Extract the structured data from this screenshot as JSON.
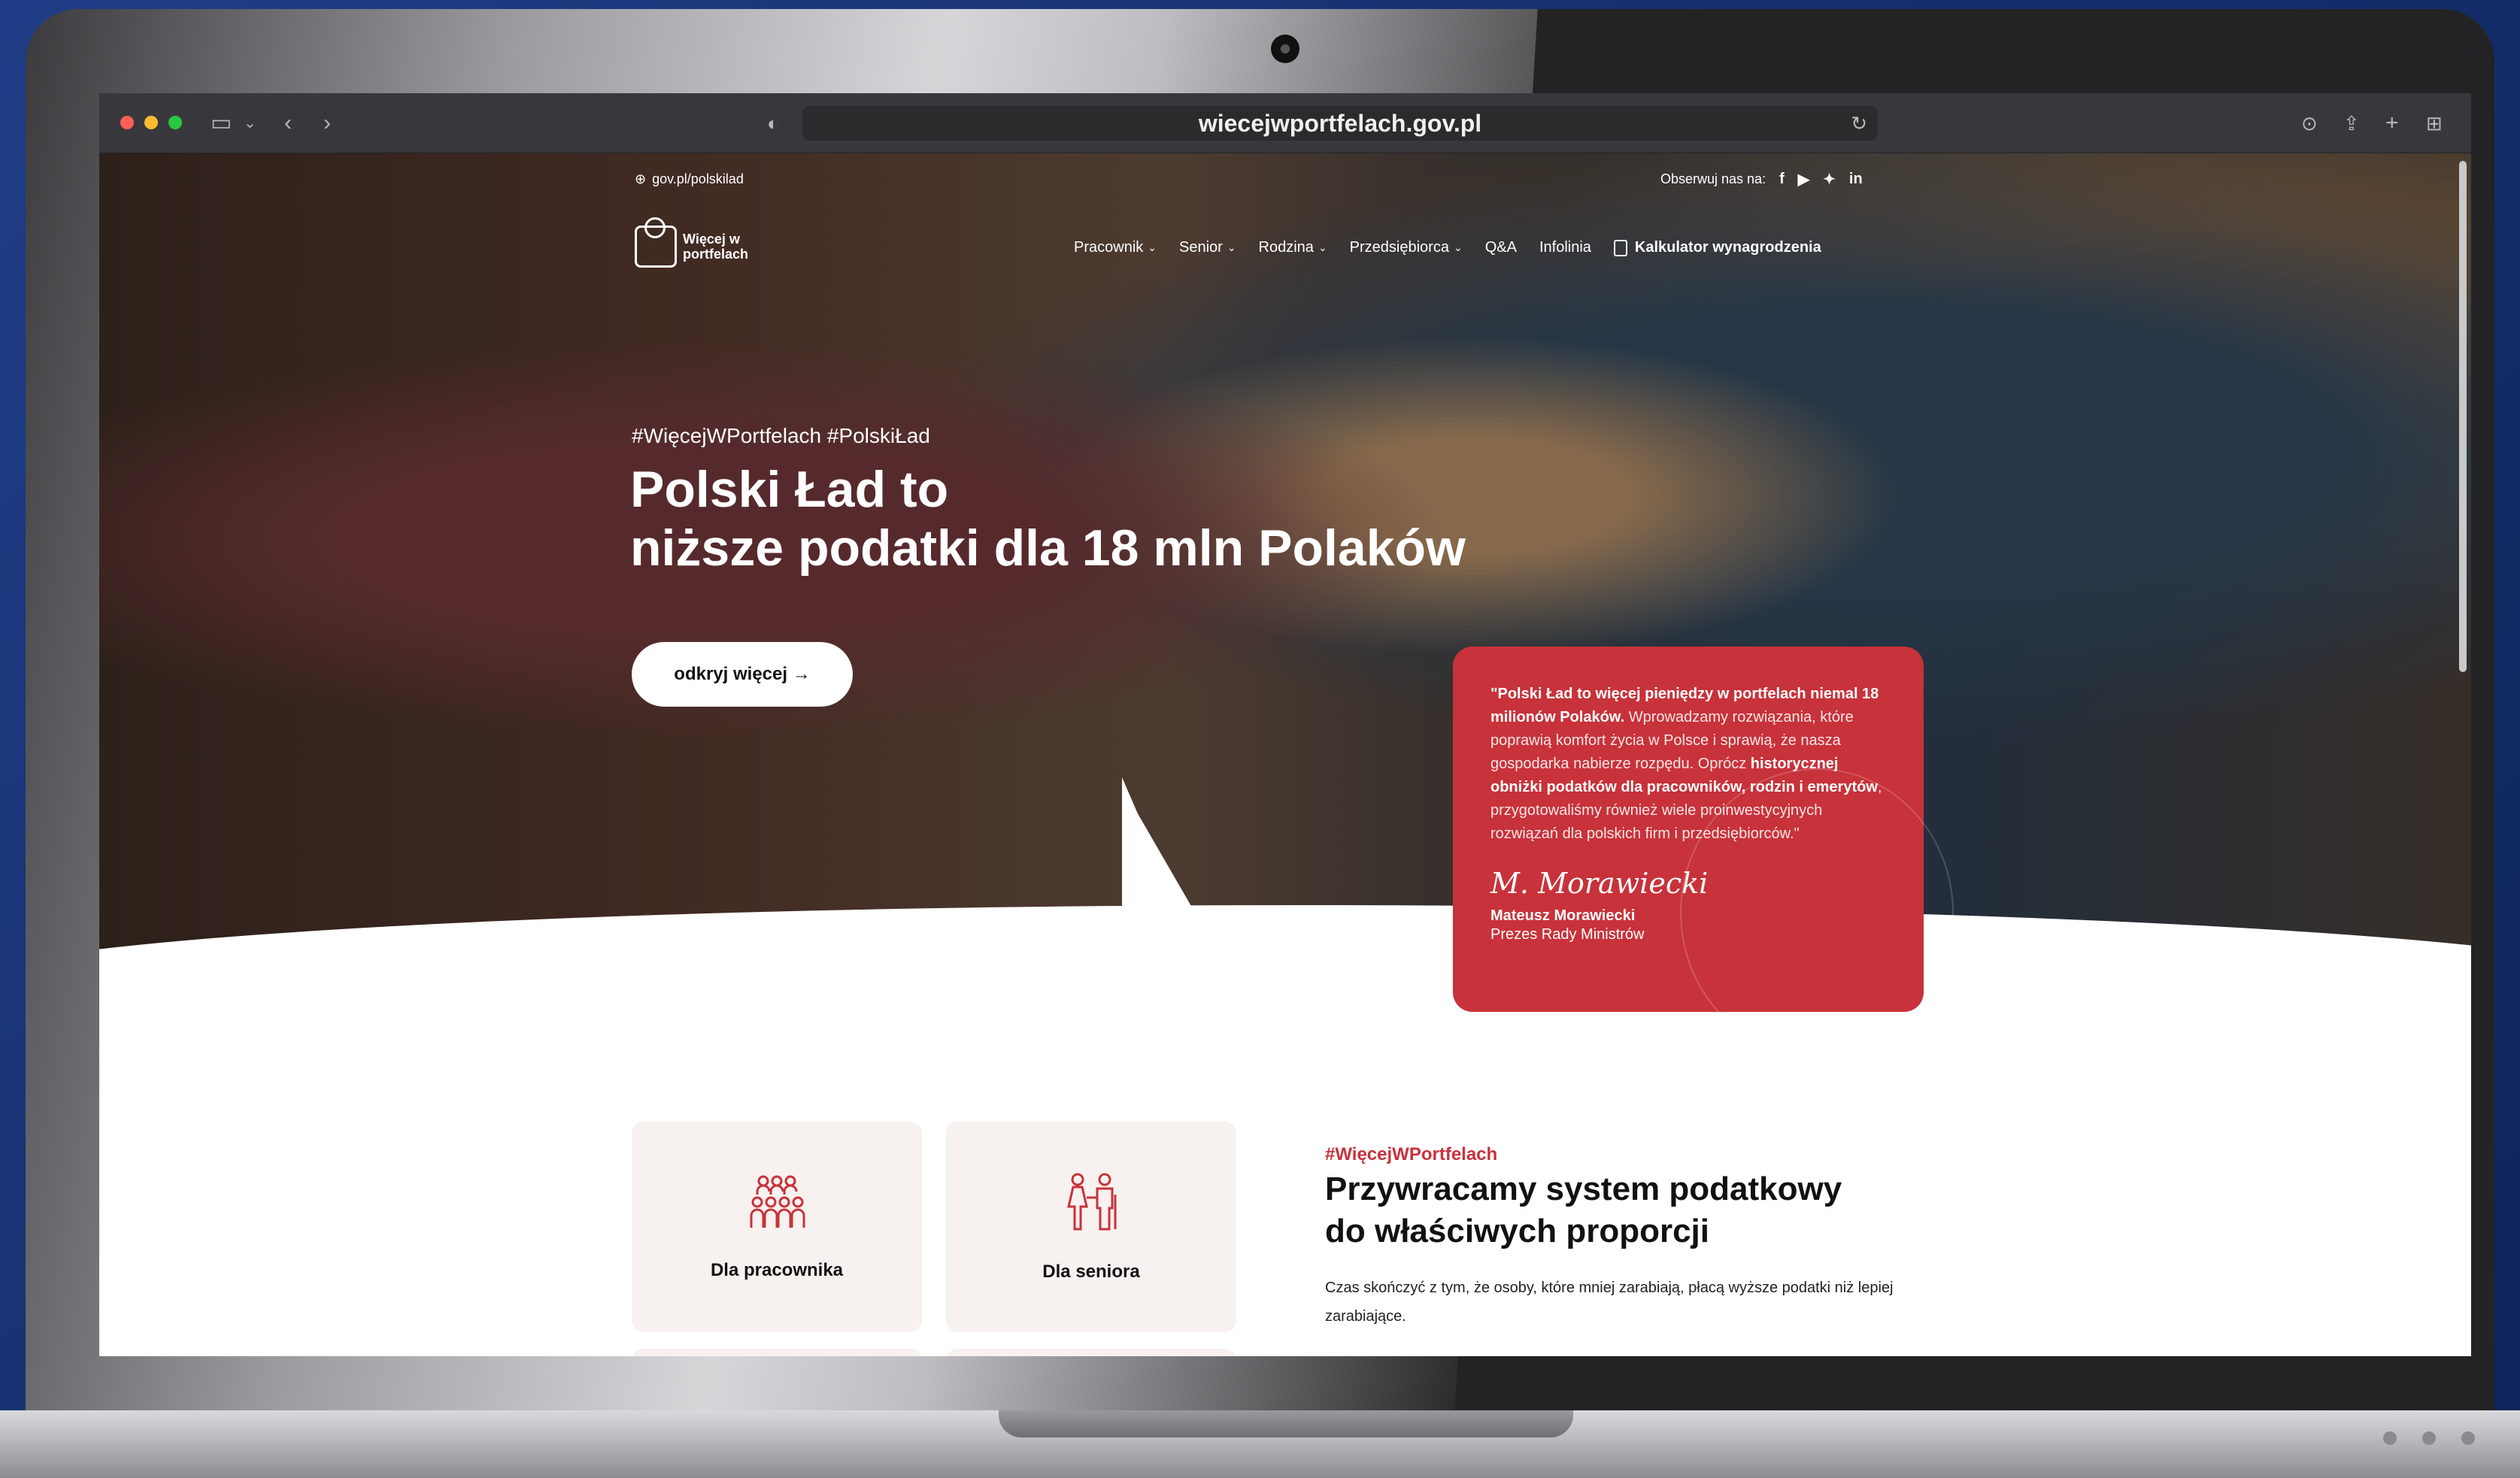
{
  "browser": {
    "url": "wiecejwportfelach.gov.pl"
  },
  "topbar": {
    "site_link": "gov.pl/polskilad",
    "follow_label": "Obserwuj nas na:"
  },
  "logo": {
    "text": "Więcej w portfelach"
  },
  "nav": {
    "items": [
      "Pracownik",
      "Senior",
      "Rodzina",
      "Przedsiębiorca",
      "Q&A",
      "Infolinia"
    ],
    "calculator": "Kalkulator wynagrodzenia"
  },
  "hero": {
    "hashtags": "#WięcejWPortfelach #PolskiŁad",
    "title_line1": "Polski Ład to",
    "title_line2": "niższe podatki dla 18 mln Polaków",
    "cta": "odkryj więcej →"
  },
  "quote": {
    "text_part1": "\"Polski Ład to więcej pieniędzy w portfelach niemal 18 milionów Polaków.",
    "text_part2": " Wprowadzamy rozwiązania, które poprawią komfort życia w Polsce i sprawią, że nasza gospodarka nabierze rozpędu. Oprócz ",
    "text_part3": "historycznej obniżki podatków dla pracowników, rodzin i emerytów",
    "text_part4": ", przygotowaliśmy również wiele proinwestycyjnych rozwiązań dla polskich firm i przedsiębiorców.\"",
    "signature": "M. Morawiecki",
    "name": "Mateusz Morawiecki",
    "role": "Prezes Rady Ministrów"
  },
  "cards": [
    {
      "label": "Dla pracownika"
    },
    {
      "label": "Dla seniora"
    }
  ],
  "section": {
    "tag": "#WięcejWPortfelach",
    "title_line1": "Przywracamy system podatkowy",
    "title_line2": "do właściwych proporcji",
    "body": "Czas skończyć z tym, że osoby, które mniej zarabiają, płacą wyższe podatki niż lepiej zarabiające."
  },
  "colors": {
    "accent": "#c8323a",
    "card_bg": "#f7f1f0"
  }
}
